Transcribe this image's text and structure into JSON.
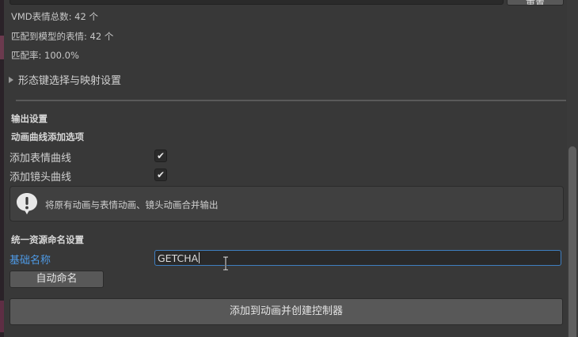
{
  "stats": {
    "vmd_total": "VMD表情总数: 42 个",
    "matched": "匹配到模型的表情: 42 个",
    "match_rate": "匹配率: 100.0%"
  },
  "foldout": {
    "label": "形态键选择与映射设置"
  },
  "output": {
    "title": "输出设置",
    "curve_options_title": "动画曲线添加选项",
    "add_expression_curve": "添加表情曲线",
    "add_camera_curve": "添加镜头曲线",
    "add_expression_curve_checked": true,
    "add_camera_curve_checked": true,
    "check_glyph": "✔"
  },
  "help": {
    "icon": "info-icon",
    "message": "将原有动画与表情动画、镜头动画合并输出"
  },
  "naming": {
    "title": "统一资源命名设置",
    "base_name_label": "基础名称",
    "base_name_value": "GETCHA",
    "auto_name_button": "自动命名"
  },
  "actions": {
    "create_button": "添加到动画并创建控制器",
    "top_button": "重置"
  },
  "colors": {
    "background": "#383838",
    "accent_label": "#4e9ae6",
    "input_focus_border": "#3f7fc1",
    "button": "#585858"
  }
}
